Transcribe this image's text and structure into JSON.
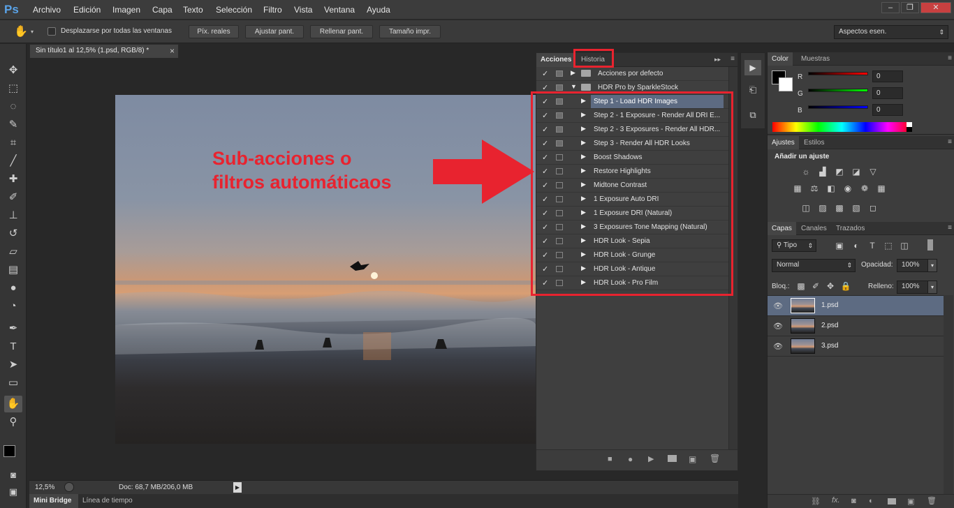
{
  "menubar": {
    "logo": "Ps",
    "items": [
      "Archivo",
      "Edición",
      "Imagen",
      "Capa",
      "Texto",
      "Selección",
      "Filtro",
      "Vista",
      "Ventana",
      "Ayuda"
    ],
    "window_buttons": [
      "–",
      "❐",
      "✕"
    ]
  },
  "options": {
    "hand_glyph": "✋",
    "scroll_all_label": "Desplazarse por todas las ventanas",
    "buttons": [
      "Píx. reales",
      "Ajustar pant.",
      "Rellenar pant.",
      "Tamaño impr."
    ],
    "workspace": "Aspectos esen."
  },
  "document": {
    "tab_title": "Sin título1 al 12,5% (1.psd, RGB/8) *",
    "close": "×",
    "zoom": "12,5%",
    "doc_info": "Doc: 68,7 MB/206,0 MB"
  },
  "bottom_tabs": [
    "Mini Bridge",
    "Línea de tiempo"
  ],
  "actions_panel": {
    "tabs": [
      "Acciones",
      "Historia"
    ],
    "sets": [
      {
        "label": "Acciones por defecto",
        "expanded": false
      },
      {
        "label": "HDR Pro by SparkleStock",
        "expanded": true
      }
    ],
    "actions": [
      {
        "label": "Step 1 - Load HDR Images",
        "dialog": true,
        "selected": true
      },
      {
        "label": "Step 2 - 1 Exposure - Render All DRI E...",
        "dialog": true
      },
      {
        "label": "Step 2 - 3 Exposures - Render All HDR...",
        "dialog": true
      },
      {
        "label": "Step 3 - Render All HDR Looks",
        "dialog": true
      },
      {
        "label": "Boost Shadows"
      },
      {
        "label": "Restore Highlights"
      },
      {
        "label": "Midtone Contrast"
      },
      {
        "label": "1 Exposure Auto DRI"
      },
      {
        "label": "1 Exposure DRI (Natural)"
      },
      {
        "label": "3 Exposures Tone Mapping (Natural)"
      },
      {
        "label": "HDR Look - Sepia"
      },
      {
        "label": "HDR Look - Grunge"
      },
      {
        "label": "HDR Look - Antique"
      },
      {
        "label": "HDR Look - Pro Film"
      }
    ],
    "bottom_icons": [
      "stop-icon",
      "record-icon",
      "play-icon",
      "new-set-icon",
      "new-action-icon",
      "trash-icon"
    ]
  },
  "annotation": {
    "text_line1": "Sub-acciones o",
    "text_line2": "filtros automáticaos"
  },
  "color_panel": {
    "tabs": [
      "Color",
      "Muestras"
    ],
    "channels": [
      {
        "name": "R",
        "value": "0",
        "color": "#ff0000"
      },
      {
        "name": "G",
        "value": "0",
        "color": "#00ff00"
      },
      {
        "name": "B",
        "value": "0",
        "color": "#0000ff"
      }
    ]
  },
  "adjustments_panel": {
    "tabs": [
      "Ajustes",
      "Estilos"
    ],
    "heading": "Añadir un ajuste"
  },
  "layers_panel": {
    "tabs": [
      "Capas",
      "Canales",
      "Trazados"
    ],
    "filter": "Tipo",
    "blend_mode": "Normal",
    "opacity_label": "Opacidad:",
    "opacity": "100%",
    "lock_label": "Bloq.:",
    "fill_label": "Relleno:",
    "fill": "100%",
    "layers": [
      {
        "name": "1.psd",
        "selected": true
      },
      {
        "name": "2.psd"
      },
      {
        "name": "3.psd"
      }
    ],
    "bottom_icons": [
      "link-icon",
      "fx-icon",
      "mask-icon",
      "adjustment-icon",
      "group-icon",
      "new-layer-icon",
      "trash-icon"
    ]
  },
  "colors": {
    "annotation_red": "#e8232f",
    "selection": "#5d6b82",
    "ps_blue": "#5aa3e8"
  }
}
